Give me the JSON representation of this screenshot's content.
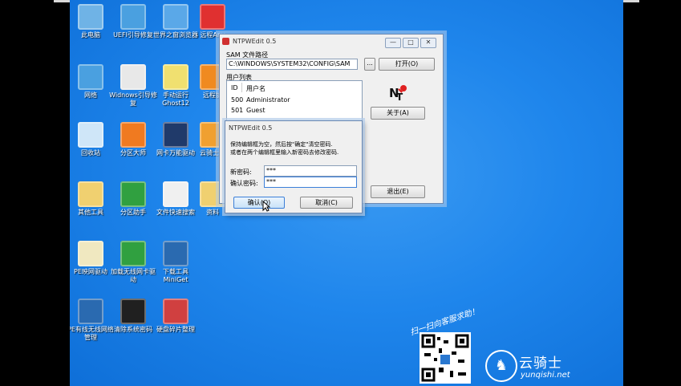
{
  "desktop": {
    "icons": [
      {
        "label": "此电脑",
        "color": "#6fb3e6"
      },
      {
        "label": "UEFI引导修复",
        "color": "#4aa0e0"
      },
      {
        "label": "世界之窗浏览器",
        "color": "#5aa8e8"
      },
      {
        "label": "远程Any",
        "color": "#e03030"
      },
      {
        "label": "网络",
        "color": "#4aa0e0"
      },
      {
        "label": "Widnows引导修复",
        "color": "#e8e8e8"
      },
      {
        "label": "手动运行Ghost12",
        "color": "#f0e070"
      },
      {
        "label": "远程协",
        "color": "#f08a20"
      },
      {
        "label": "回收站",
        "color": "#cfe6f8"
      },
      {
        "label": "分区大师",
        "color": "#f07a20"
      },
      {
        "label": "网卡万能驱动",
        "color": "#203a6a"
      },
      {
        "label": "云骑士工",
        "color": "#f0a030"
      },
      {
        "label": "其他工具",
        "color": "#f0d070"
      },
      {
        "label": "分区助手",
        "color": "#30a040"
      },
      {
        "label": "文件快速搜索",
        "color": "#f0f0f0"
      },
      {
        "label": "资料",
        "color": "#f0d070"
      },
      {
        "label": "PE映网驱动",
        "color": "#f0e8c0"
      },
      {
        "label": "加载无线网卡驱动",
        "color": "#30a040"
      },
      {
        "label": "下载工具MiniGet",
        "color": "#2a6ab0"
      },
      {
        "label": "PE有线无线网络管理",
        "color": "#2a6ab0"
      },
      {
        "label": "清除系统密码",
        "color": "#202020"
      },
      {
        "label": "硬盘碎片整理",
        "color": "#d04040"
      }
    ],
    "promo": {
      "slogan": "扫一扫向客服求助！",
      "brand": "云骑士",
      "url": "yunqishi.net"
    }
  },
  "main_window": {
    "title": "NTPWEdit 0.5",
    "sam_label": "SAM 文件路径",
    "sam_path": "C:\\WINDOWS\\SYSTEM32\\CONFIG\\SAM",
    "browse_label": "...",
    "open_label": "打开(O)",
    "users_label": "用户列表",
    "col_id": "ID",
    "col_name": "用户名",
    "users": [
      {
        "id": "500",
        "name": "Administrator"
      },
      {
        "id": "501",
        "name": "Guest"
      }
    ],
    "about_label": "关于(A)",
    "exit_label": "退出(E)",
    "minimize": "—",
    "maximize": "□",
    "close": "✕"
  },
  "dialog": {
    "title": "NTPWEdit 0.5",
    "hint_line1": "保持编辑框为空，然后按\"确定\"清空密码.",
    "hint_line2": "或者在两个编辑框里输入新密码去修改密码.",
    "new_pw_label": "新密码:",
    "new_pw_value": "***",
    "confirm_pw_label": "确认密码:",
    "confirm_pw_value": "***",
    "ok_label": "确认(O)",
    "cancel_label": "取消(C)"
  }
}
